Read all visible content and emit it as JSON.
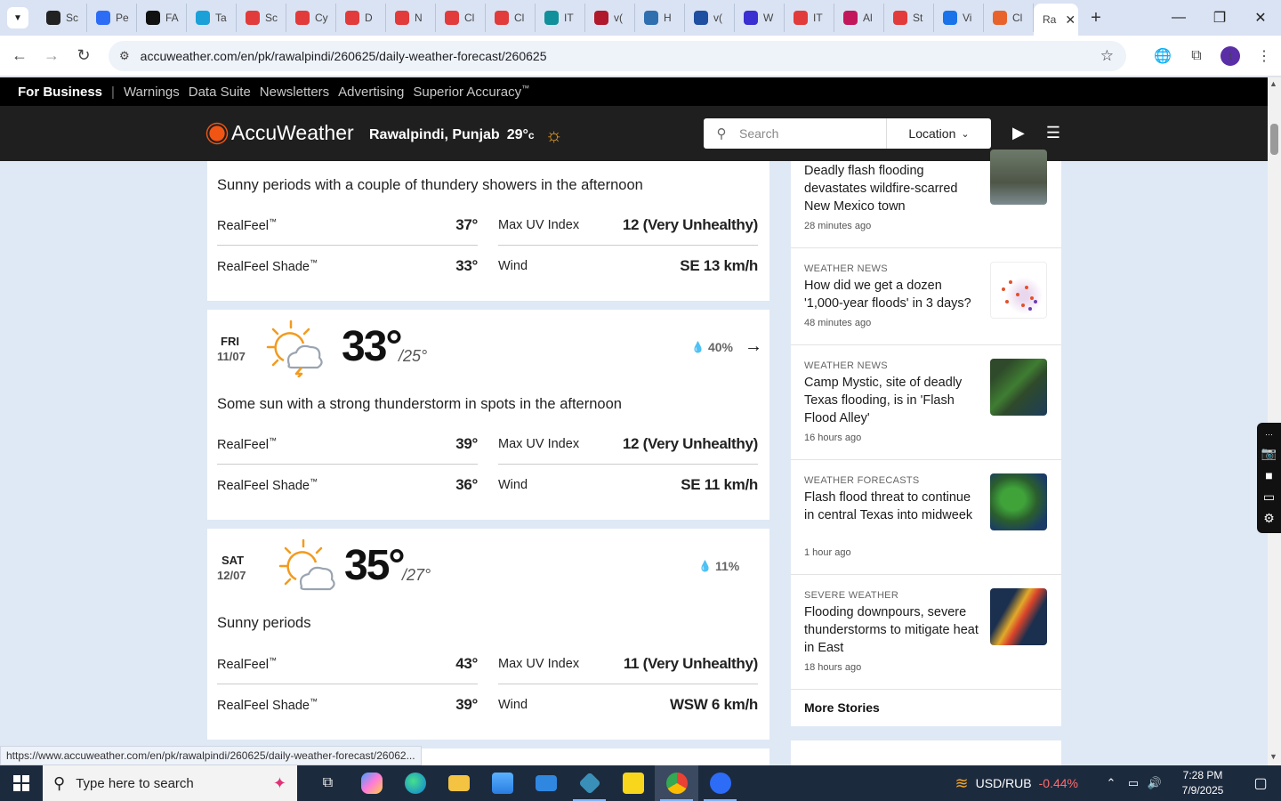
{
  "browser": {
    "tabs": [
      {
        "label": "Sc",
        "color": "#222222"
      },
      {
        "label": "Pe",
        "color": "#2d6df6"
      },
      {
        "label": "FA",
        "color": "#111111"
      },
      {
        "label": "Ta",
        "color": "#1ca0d8"
      },
      {
        "label": "Sc",
        "color": "#e23b3b"
      },
      {
        "label": "Cy",
        "color": "#e23b3b"
      },
      {
        "label": "D",
        "color": "#e23b3b"
      },
      {
        "label": "N",
        "color": "#e23b3b"
      },
      {
        "label": "Cl",
        "color": "#e23b3b"
      },
      {
        "label": "Cl",
        "color": "#e23b3b"
      },
      {
        "label": "IT",
        "color": "#10909a"
      },
      {
        "label": "v(",
        "color": "#b0182c"
      },
      {
        "label": "H",
        "color": "#2f6fb0"
      },
      {
        "label": "v(",
        "color": "#1f4fa0"
      },
      {
        "label": "W",
        "color": "#3a2fd0"
      },
      {
        "label": "IT",
        "color": "#e23b3b"
      },
      {
        "label": "Al",
        "color": "#c2185b"
      },
      {
        "label": "St",
        "color": "#e23b3b"
      },
      {
        "label": "Vi",
        "color": "#1a73e8"
      },
      {
        "label": "Cl",
        "color": "#e8632b"
      }
    ],
    "active_tab": {
      "label": "Ra"
    },
    "url": "accuweather.com/en/pk/rawalpindi/260625/daily-weather-forecast/260625",
    "avatar_initial": "t",
    "status_link": "https://www.accuweather.com/en/pk/rawalpindi/260625/daily-weather-forecast/26062..."
  },
  "site": {
    "bizbar": {
      "for_business": "For Business",
      "separator": "|",
      "links": [
        "Warnings",
        "Data Suite",
        "Newsletters",
        "Advertising",
        "Superior Accuracy"
      ],
      "tm": "™"
    },
    "brand": "AccuWeather",
    "location": "Rawalpindi, Punjab",
    "current_temp": "29°",
    "current_unit": "c",
    "search_placeholder": "Search",
    "location_btn": "Location"
  },
  "forecast": {
    "partial_day": {
      "phrase": "Sunny periods with a couple of thundery showers in the afternoon",
      "realfeel": "37°",
      "realfeel_shade": "33°",
      "max_uv": "12 (Very Unhealthy)",
      "wind": "SE 13 km/h"
    },
    "days": [
      {
        "dow": "FRI",
        "date": "11/07",
        "high": "33°",
        "low": "/25°",
        "precip": "40%",
        "icon": "sun-cloud-thunder-icon",
        "phrase": "Some sun with a strong thunderstorm in spots in the afternoon",
        "realfeel": "39°",
        "realfeel_shade": "36°",
        "max_uv": "12 (Very Unhealthy)",
        "wind": "SE 11 km/h"
      },
      {
        "dow": "SAT",
        "date": "12/07",
        "high": "35°",
        "low": "/27°",
        "precip": "11%",
        "icon": "sun-cloud-icon",
        "phrase": "Sunny periods",
        "realfeel": "43°",
        "realfeel_shade": "39°",
        "max_uv": "11 (Very Unhealthy)",
        "wind": "WSW 6 km/h"
      }
    ],
    "labels": {
      "realfeel": "RealFeel",
      "realfeel_shade": "RealFeel Shade",
      "tm": "™",
      "max_uv": "Max UV Index",
      "wind": "Wind"
    }
  },
  "news": {
    "items": [
      {
        "category": "",
        "title": "Deadly flash flooding devastates wildfire-scarred New Mexico town",
        "time": "28 minutes ago"
      },
      {
        "category": "WEATHER NEWS",
        "title": "How did we get a dozen '1,000-year floods' in 3 days?",
        "time": "48 minutes ago"
      },
      {
        "category": "WEATHER NEWS",
        "title": "Camp Mystic, site of deadly Texas flooding, is in 'Flash Flood Alley'",
        "time": "16 hours ago"
      },
      {
        "category": "WEATHER FORECASTS",
        "title": "Flash flood threat to continue in central Texas into midweek",
        "time": "1 hour ago"
      },
      {
        "category": "SEVERE WEATHER",
        "title": "Flooding downpours, severe thunderstorms to mitigate heat in East",
        "time": "18 hours ago"
      }
    ],
    "more_label": "More Stories"
  },
  "taskbar": {
    "search_placeholder": "Type here to search",
    "ticker_pair": "USD/RUB",
    "ticker_change": "-0.44%",
    "time": "7:28 PM",
    "date": "7/9/2025"
  }
}
